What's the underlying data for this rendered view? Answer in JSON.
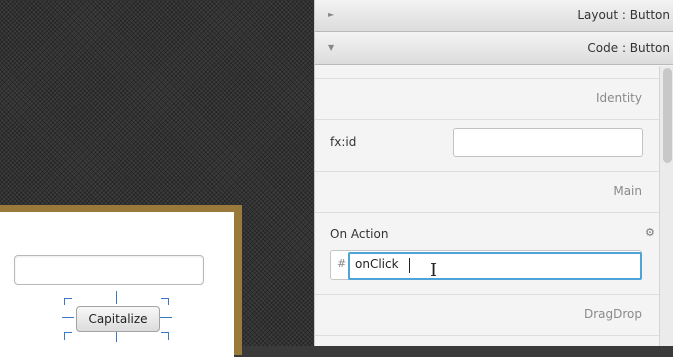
{
  "sections": {
    "layout_title": "Layout : Button",
    "code_title": "Code : Button",
    "layout_arrow": "►",
    "code_arrow": "▼"
  },
  "code_panel": {
    "identity_header": "Identity",
    "fxid_label": "fx:id",
    "fxid_value": "",
    "main_header": "Main",
    "on_action_label": "On Action",
    "on_action_prefix": "#",
    "on_action_value": "onClick",
    "dragdrop_header": "DragDrop"
  },
  "canvas": {
    "button_label": "Capitalize",
    "text_field_value": ""
  },
  "colors": {
    "focus_border": "#4ea3d8",
    "selection_handle": "#3b78c4",
    "stage_frame": "#9a7a3a"
  }
}
